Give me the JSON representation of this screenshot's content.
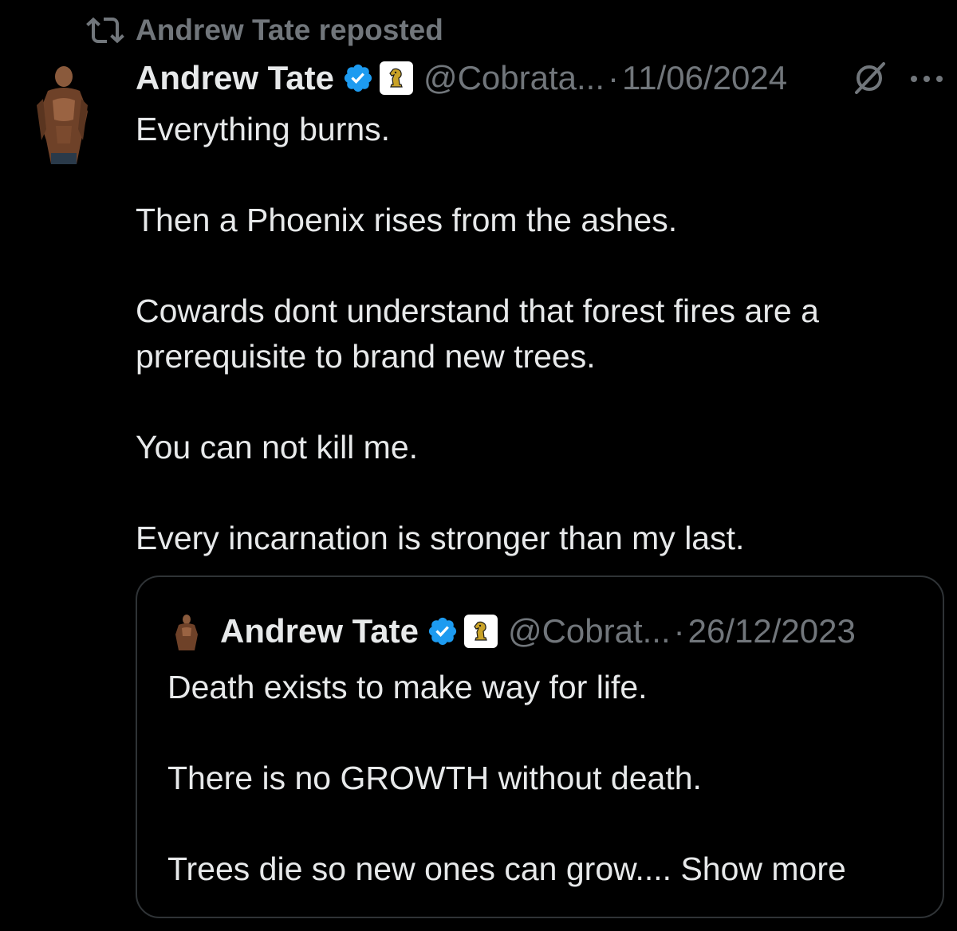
{
  "repost": {
    "icon": "repost-icon",
    "text": "Andrew Tate reposted"
  },
  "tweet": {
    "avatar": "avatar",
    "name": "Andrew Tate",
    "verified_icon": "verified-icon",
    "badge_icon": "chess-knight-badge-icon",
    "handle": "@Cobrata...",
    "separator": "·",
    "date": "11/06/2024",
    "grok_icon": "grok-icon",
    "more_icon": "more-icon",
    "body": [
      "Everything burns.",
      "Then a Phoenix rises from the ashes.",
      "Cowards dont understand that forest fires are a prerequisite to brand new trees.",
      "You can not kill me.",
      "Every incarnation is stronger than my last."
    ]
  },
  "quoted": {
    "avatar": "avatar",
    "name": "Andrew Tate",
    "verified_icon": "verified-icon",
    "badge_icon": "chess-knight-badge-icon",
    "handle": "@Cobrat...",
    "separator": "·",
    "date": "26/12/2023",
    "body": [
      "Death exists to make way for life.",
      "There is no GROWTH without death."
    ],
    "last_line": "Trees die so new ones can grow....",
    "show_more": "Show more"
  },
  "colors": {
    "background": "#000000",
    "text": "#e7e9ea",
    "secondary": "#71767b",
    "verified": "#1d9bf0",
    "border": "#2f3336",
    "badge_gold": "#c9a227"
  }
}
